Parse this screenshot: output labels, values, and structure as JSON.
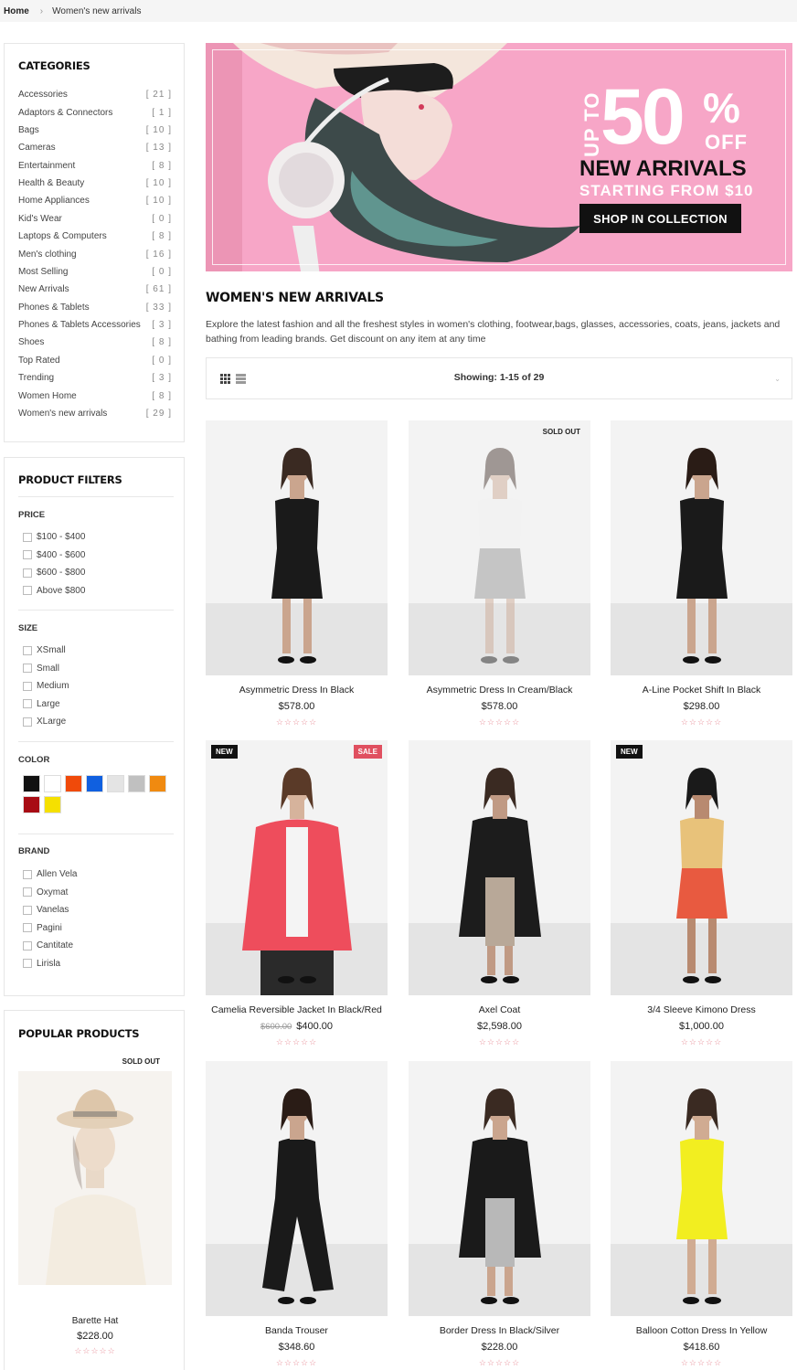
{
  "breadcrumb": {
    "home": "Home",
    "separator": "›",
    "current": "Women's new arrivals"
  },
  "categories": {
    "title": "CATEGORIES",
    "items": [
      {
        "label": "Accessories",
        "count": "[ 21 ]"
      },
      {
        "label": "Adaptors & Connectors",
        "count": "[ 1 ]"
      },
      {
        "label": "Bags",
        "count": "[ 10 ]"
      },
      {
        "label": "Cameras",
        "count": "[ 13 ]"
      },
      {
        "label": "Entertainment",
        "count": "[ 8 ]"
      },
      {
        "label": "Health & Beauty",
        "count": "[ 10 ]"
      },
      {
        "label": "Home Appliances",
        "count": "[ 10 ]"
      },
      {
        "label": "Kid's Wear",
        "count": "[ 0 ]"
      },
      {
        "label": "Laptops & Computers",
        "count": "[ 8 ]"
      },
      {
        "label": "Men's clothing",
        "count": "[ 16 ]"
      },
      {
        "label": "Most Selling",
        "count": "[ 0 ]"
      },
      {
        "label": "New Arrivals",
        "count": "[ 61 ]"
      },
      {
        "label": "Phones & Tablets",
        "count": "[ 33 ]"
      },
      {
        "label": "Phones & Tablets Accessories",
        "count": "[ 3 ]"
      },
      {
        "label": "Shoes",
        "count": "[ 8 ]"
      },
      {
        "label": "Top Rated",
        "count": "[ 0 ]"
      },
      {
        "label": "Trending",
        "count": "[ 3 ]"
      },
      {
        "label": "Women Home",
        "count": "[ 8 ]"
      },
      {
        "label": "Women's new arrivals",
        "count": "[ 29 ]"
      }
    ]
  },
  "filters": {
    "title": "PRODUCT FILTERS",
    "price": {
      "heading": "PRICE",
      "options": [
        "$100 - $400",
        "$400 - $600",
        "$600 - $800",
        "Above $800"
      ]
    },
    "size": {
      "heading": "SIZE",
      "options": [
        "XSmall",
        "Small",
        "Medium",
        "Large",
        "XLarge"
      ]
    },
    "color": {
      "heading": "COLOR",
      "swatches": [
        "#111111",
        "#ffffff",
        "#f04a0a",
        "#1060e0",
        "#e4e4e4",
        "#c0c0c0",
        "#f08a10",
        "#a80c14",
        "#f5e000"
      ]
    },
    "brand": {
      "heading": "BRAND",
      "options": [
        "Allen Vela",
        "Oxymat",
        "Vanelas",
        "Pagini",
        "Cantitate",
        "Lirisla"
      ]
    }
  },
  "popular": {
    "title": "POPULAR PRODUCTS",
    "badge": "SOLD OUT",
    "name": "Barette Hat",
    "price": "$228.00",
    "stars": "☆☆☆☆☆"
  },
  "banner": {
    "upto": "UP TO",
    "percent": "50",
    "pct_sign": "%",
    "off": "OFF",
    "headline": "NEW ARRIVALS",
    "sub": "STARTING FROM $10",
    "button": "SHOP IN COLLECTION",
    "bg_color": "#f7a6c7"
  },
  "section": {
    "title": "WOMEN'S NEW ARRIVALS",
    "description": "Explore the latest fashion and all the freshest styles in women's clothing, footwear,bags, glasses, accessories, coats, jeans, jackets and bathing from leading brands. Get discount on any item at any time"
  },
  "toolbar": {
    "showing": "Showing: 1-15 of 29"
  },
  "products": [
    {
      "name": "Asymmetric Dress In Black",
      "price": "$578.00",
      "old_price": "",
      "badges": [],
      "stars": "☆☆☆☆☆",
      "faded": false
    },
    {
      "name": "Asymmetric Dress In Cream/Black",
      "price": "$578.00",
      "old_price": "",
      "badges": [
        "SOLD OUT"
      ],
      "stars": "☆☆☆☆☆",
      "faded": true
    },
    {
      "name": "A-Line Pocket Shift In Black",
      "price": "$298.00",
      "old_price": "",
      "badges": [],
      "stars": "☆☆☆☆☆",
      "faded": false
    },
    {
      "name": "Camelia Reversible Jacket In Black/Red",
      "price": "$400.00",
      "old_price": "$600.00",
      "badges": [
        "NEW",
        "SALE"
      ],
      "stars": "☆☆☆☆☆",
      "faded": false
    },
    {
      "name": "Axel Coat",
      "price": "$2,598.00",
      "old_price": "",
      "badges": [],
      "stars": "☆☆☆☆☆",
      "faded": false
    },
    {
      "name": "3/4 Sleeve Kimono Dress",
      "price": "$1,000.00",
      "old_price": "",
      "badges": [
        "NEW"
      ],
      "stars": "☆☆☆☆☆",
      "faded": false
    },
    {
      "name": "Banda Trouser",
      "price": "$348.60",
      "old_price": "",
      "badges": [],
      "stars": "☆☆☆☆☆",
      "faded": false
    },
    {
      "name": "Border Dress In Black/Silver",
      "price": "$228.00",
      "old_price": "",
      "badges": [],
      "stars": "☆☆☆☆☆",
      "faded": false
    },
    {
      "name": "Balloon Cotton Dress In Yellow",
      "price": "$418.60",
      "old_price": "",
      "badges": [],
      "stars": "☆☆☆☆☆",
      "faded": false
    }
  ]
}
